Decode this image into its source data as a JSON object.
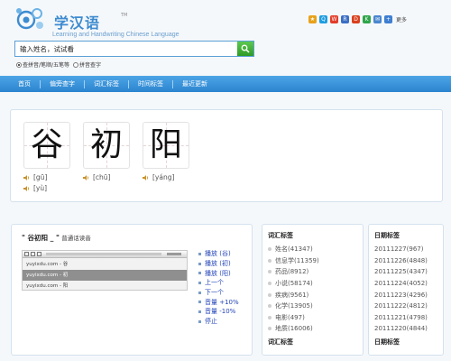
{
  "header": {
    "logo_title": "学汉语",
    "logo_tm": "TM",
    "logo_subtitle": "Learning and Handwriting Chinese Language",
    "share_more": "更多"
  },
  "search": {
    "value": "输入姓名，试试看",
    "options": [
      "查拼音/笔顺/五笔等",
      "拼音查字"
    ]
  },
  "nav": {
    "items": [
      "首页",
      "偏旁查字",
      "词汇标签",
      "时间标签",
      "最近更新"
    ]
  },
  "characters": {
    "glyphs": [
      "谷",
      "初",
      "阳"
    ],
    "pinyin": [
      "[gū]",
      "[chū]",
      "[yáng]",
      "[yù]"
    ]
  },
  "audio": {
    "title": "\" 谷初阳 _ \"",
    "subtitle": "普通话读音",
    "playlist": [
      "yuyixdu.com - 谷",
      "yuyixdu.com - 初",
      "yuyixdu.com - 阳"
    ],
    "controls": [
      "播放 (谷)",
      "播放 (初)",
      "播放 (阳)",
      "上一个",
      "下一个",
      "音量 +10%",
      "音量 -10%",
      "停止"
    ]
  },
  "vocab": {
    "heading": "词汇标签",
    "items": [
      "姓名(41347)",
      "信息学(11359)",
      "药品(8912)",
      "小说(58174)",
      "疾病(9561)",
      "化学(13905)",
      "电影(497)",
      "地质(16006)"
    ],
    "footer": "词汇标签"
  },
  "dates": {
    "heading": "日期标签",
    "items": [
      "20111227(967)",
      "20111226(4848)",
      "20111225(4347)",
      "20111224(4052)",
      "20111223(4296)",
      "20111222(4812)",
      "20111221(4798)",
      "20111220(4844)"
    ],
    "footer": "日期标签"
  },
  "colors": {
    "accent": "#3d8bd0",
    "nav_bg": "#2b84cf",
    "search_button": "#3aa830",
    "link": "#2344b8"
  }
}
